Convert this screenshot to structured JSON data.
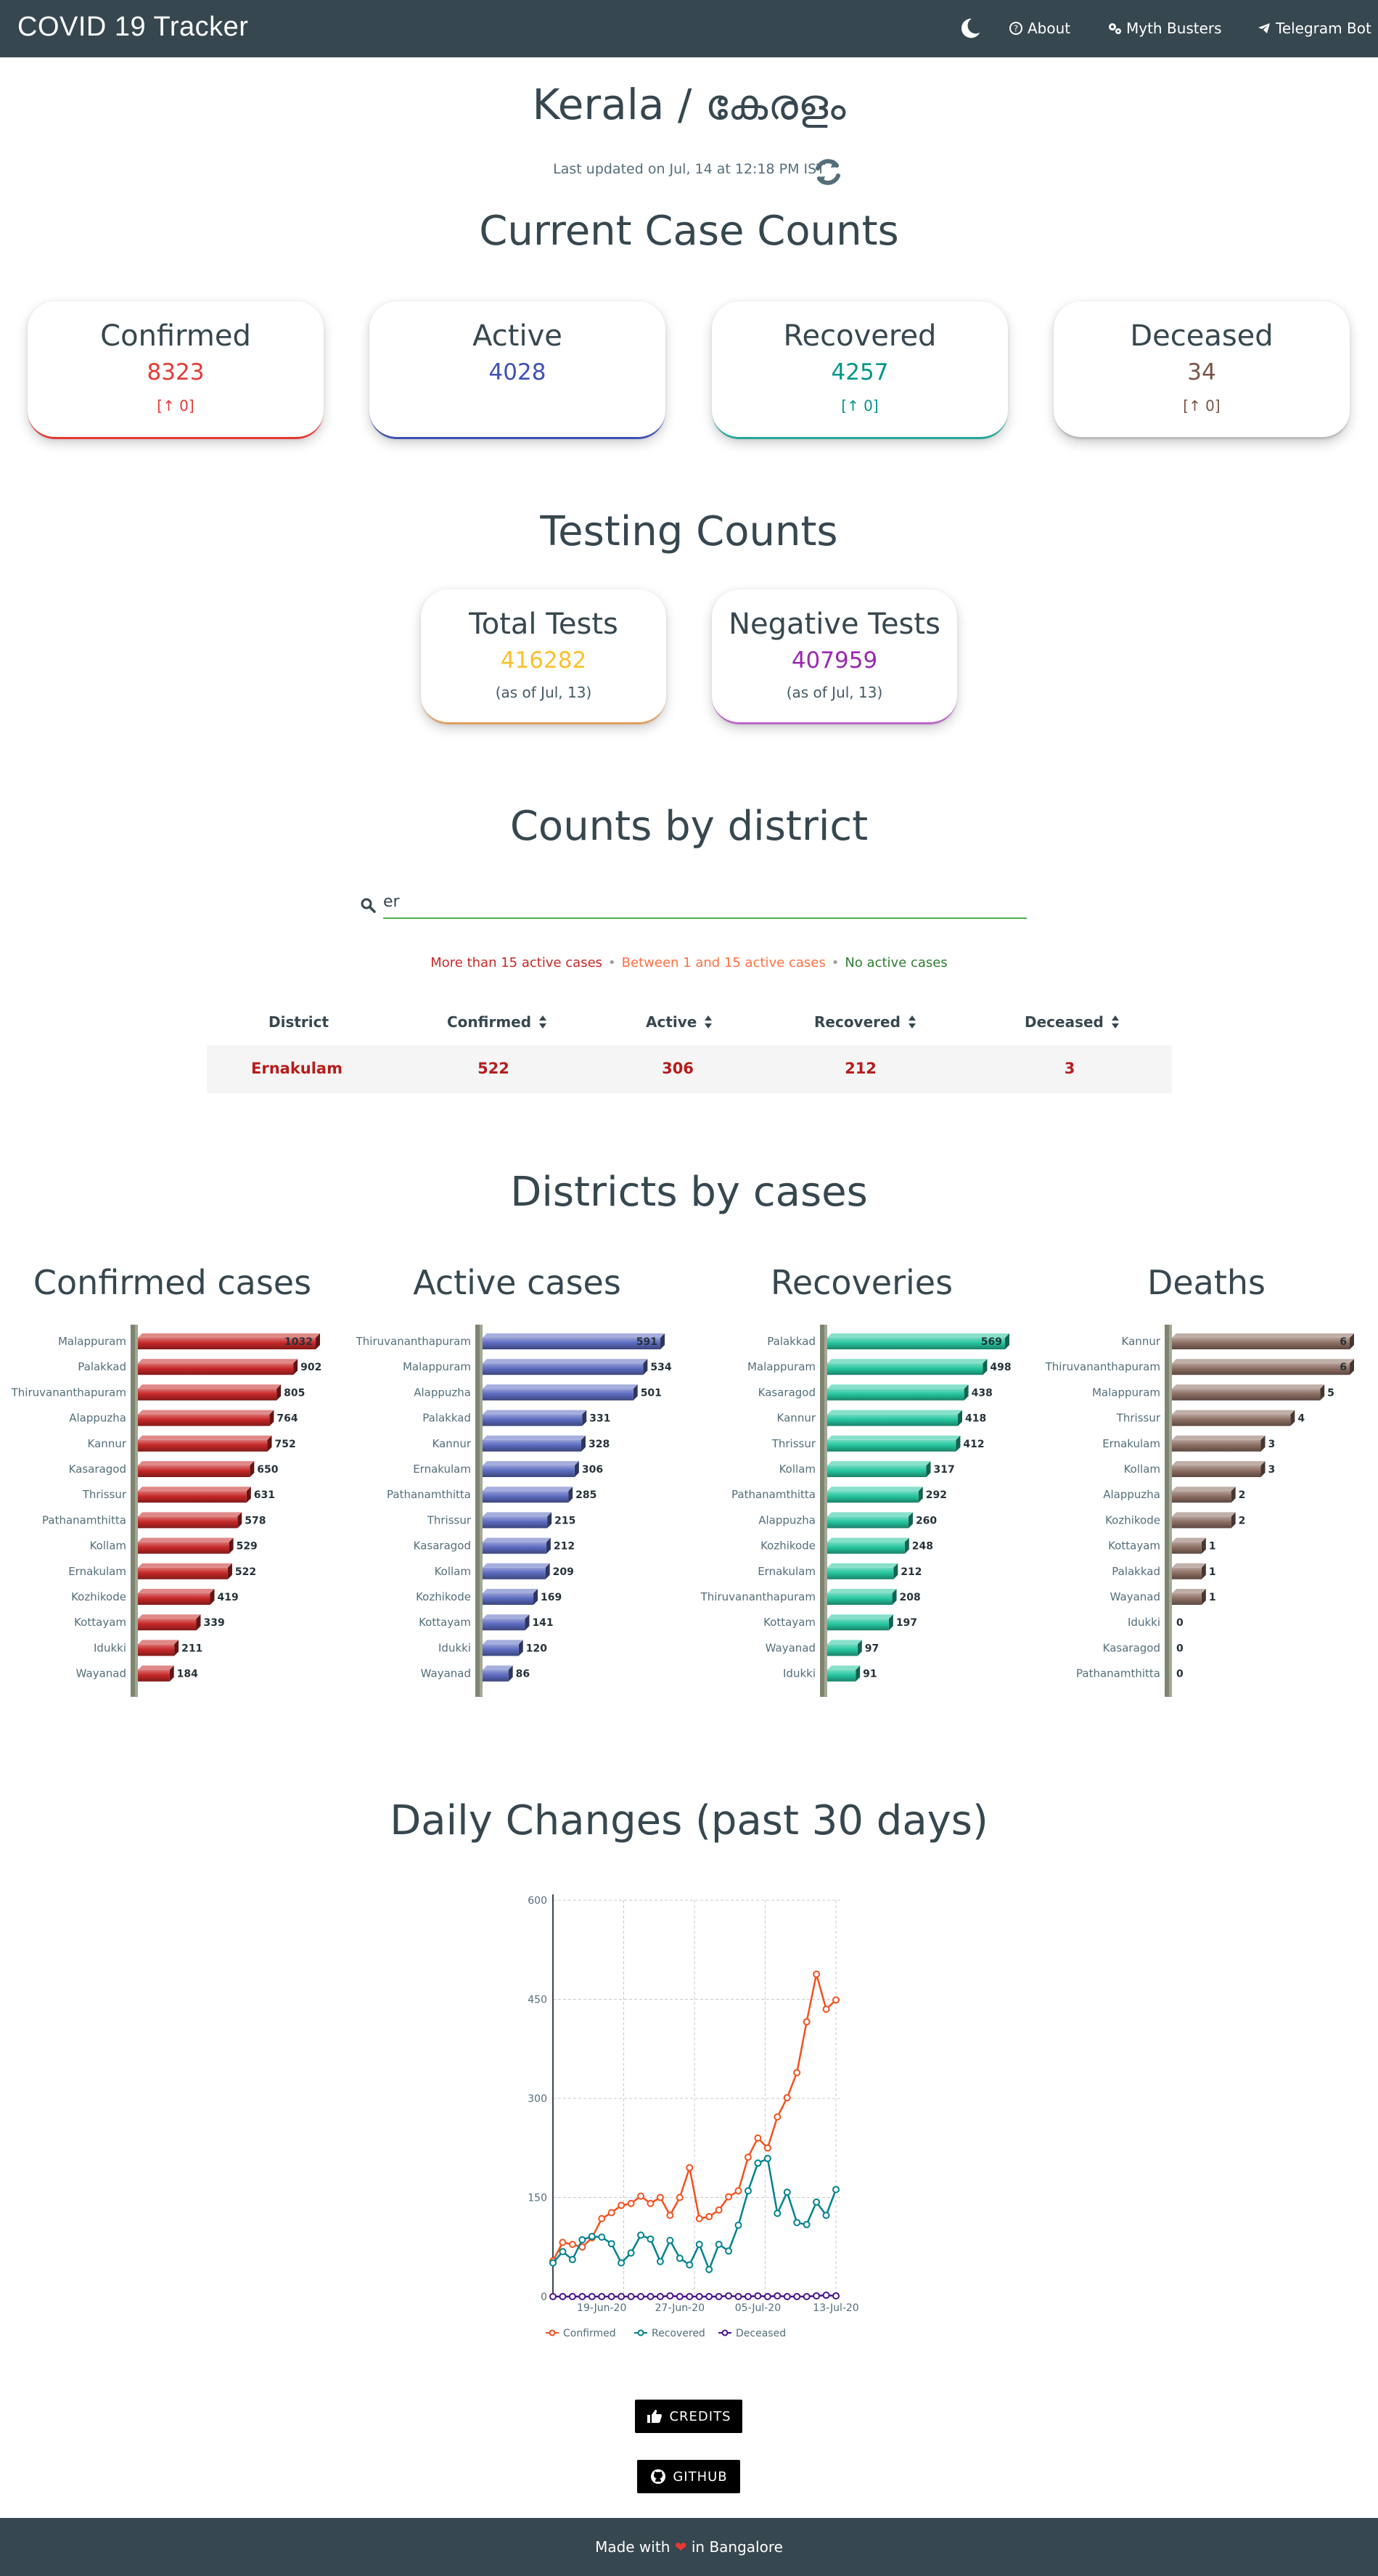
{
  "nav": {
    "brand": "COVID 19 Tracker",
    "about": "About",
    "myth": "Myth Busters",
    "telegram": "Telegram Bot"
  },
  "header": {
    "title": "Kerala / കേരളം",
    "updated": "Last updated on Jul, 14 at 12:18 PM IST"
  },
  "current": {
    "section_title": "Current Case Counts",
    "cards": [
      {
        "title": "Confirmed",
        "value": "8323",
        "delta": "[↑ 0]",
        "color": "#e53935"
      },
      {
        "title": "Active",
        "value": "4028",
        "delta": "",
        "color": "#3f51b5"
      },
      {
        "title": "Recovered",
        "value": "4257",
        "delta": "[↑ 0]",
        "color": "#009688"
      },
      {
        "title": "Deceased",
        "value": "34",
        "delta": "[↑ 0]",
        "color": "#795548"
      }
    ]
  },
  "testing": {
    "section_title": "Testing Counts",
    "cards": [
      {
        "title": "Total Tests",
        "value": "416282",
        "note": "(as of Jul, 13)",
        "color": "#fbc02d"
      },
      {
        "title": "Negative Tests",
        "value": "407959",
        "note": "(as of Jul, 13)",
        "color": "#9c27b0"
      }
    ]
  },
  "district": {
    "section_title": "Counts by district",
    "search_value": "er",
    "legend": {
      "high": "More than 15 active cases",
      "mid": "Between 1 and 15 active cases",
      "none": "No active cases",
      "sep": "•"
    },
    "columns": [
      "District",
      "Confirmed",
      "Active",
      "Recovered",
      "Deceased"
    ],
    "rows": [
      [
        "Ernakulam",
        "522",
        "306",
        "212",
        "3"
      ]
    ]
  },
  "districts_by_cases": {
    "section_title": "Districts by cases",
    "charts": [
      {
        "title": "Confirmed cases",
        "color": "#c62828",
        "labels": [
          "Malappuram",
          "Palakkad",
          "Thiruvananthapuram",
          "Alappuzha",
          "Kannur",
          "Kasaragod",
          "Thrissur",
          "Pathanamthitta",
          "Kollam",
          "Ernakulam",
          "Kozhikode",
          "Kottayam",
          "Idukki",
          "Wayanad"
        ],
        "values": [
          1032,
          902,
          805,
          764,
          752,
          650,
          631,
          578,
          529,
          522,
          419,
          339,
          211,
          184
        ]
      },
      {
        "title": "Active cases",
        "color": "#5c6bc0",
        "labels": [
          "Thiruvananthapuram",
          "Malappuram",
          "Alappuzha",
          "Palakkad",
          "Kannur",
          "Ernakulam",
          "Pathanamthitta",
          "Thrissur",
          "Kasaragod",
          "Kollam",
          "Kozhikode",
          "Kottayam",
          "Idukki",
          "Wayanad"
        ],
        "values": [
          591,
          534,
          501,
          331,
          328,
          306,
          285,
          215,
          212,
          209,
          169,
          141,
          120,
          86
        ]
      },
      {
        "title": "Recoveries",
        "color": "#26c6a0",
        "labels": [
          "Palakkad",
          "Malappuram",
          "Kasaragod",
          "Kannur",
          "Thrissur",
          "Kollam",
          "Pathanamthitta",
          "Alappuzha",
          "Kozhikode",
          "Ernakulam",
          "Thiruvananthapuram",
          "Kottayam",
          "Wayanad",
          "Idukki"
        ],
        "values": [
          569,
          498,
          438,
          418,
          412,
          317,
          292,
          260,
          248,
          212,
          208,
          197,
          97,
          91
        ]
      },
      {
        "title": "Deaths",
        "color": "#8d6e63",
        "labels": [
          "Kannur",
          "Thiruvananthapuram",
          "Malappuram",
          "Thrissur",
          "Ernakulam",
          "Kollam",
          "Alappuzha",
          "Kozhikode",
          "Kottayam",
          "Palakkad",
          "Wayanad",
          "Idukki",
          "Kasaragod",
          "Pathanamthitta"
        ],
        "values": [
          6,
          6,
          5,
          4,
          3,
          3,
          2,
          2,
          1,
          1,
          1,
          0,
          0,
          0
        ]
      }
    ]
  },
  "daily": {
    "section_title": "Daily Changes (past 30 days)"
  },
  "chart_data": {
    "type": "line",
    "x": [
      "14-Jun-20",
      "15-Jun-20",
      "16-Jun-20",
      "17-Jun-20",
      "18-Jun-20",
      "19-Jun-20",
      "20-Jun-20",
      "21-Jun-20",
      "22-Jun-20",
      "23-Jun-20",
      "24-Jun-20",
      "25-Jun-20",
      "26-Jun-20",
      "27-Jun-20",
      "28-Jun-20",
      "29-Jun-20",
      "30-Jun-20",
      "01-Jul-20",
      "02-Jul-20",
      "03-Jul-20",
      "04-Jul-20",
      "05-Jul-20",
      "06-Jul-20",
      "07-Jul-20",
      "08-Jul-20",
      "09-Jul-20",
      "10-Jul-20",
      "11-Jul-20",
      "12-Jul-20",
      "13-Jul-20"
    ],
    "xticks": [
      "19-Jun-20",
      "27-Jun-20",
      "05-Jul-20",
      "13-Jul-20"
    ],
    "ylim": [
      0,
      600
    ],
    "yticks": [
      0,
      150,
      300,
      450,
      600
    ],
    "grid": true,
    "legend_position": "bottom",
    "series": [
      {
        "name": "Confirmed",
        "color": "#f4511e",
        "values": [
          54,
          82,
          79,
          75,
          89,
          118,
          127,
          138,
          141,
          152,
          141,
          150,
          123,
          150,
          195,
          118,
          121,
          131,
          151,
          160,
          211,
          240,
          225,
          272,
          301,
          339,
          416,
          488,
          435,
          449
        ]
      },
      {
        "name": "Recovered",
        "color": "#00838f",
        "values": [
          51,
          68,
          56,
          86,
          91,
          90,
          80,
          51,
          66,
          93,
          87,
          53,
          85,
          58,
          48,
          79,
          41,
          79,
          69,
          108,
          160,
          202,
          209,
          126,
          158,
          112,
          109,
          143,
          123,
          162
        ]
      },
      {
        "name": "Deceased",
        "color": "#4a148c",
        "values": [
          0,
          0,
          0,
          0,
          0,
          0,
          0,
          0,
          0,
          0,
          0,
          0,
          1,
          0,
          0,
          0,
          0,
          0,
          1,
          0,
          0,
          1,
          0,
          1,
          0,
          0,
          0,
          1,
          2,
          1
        ]
      }
    ]
  },
  "buttons": {
    "credits": "CREDITS",
    "github": "GITHUB"
  },
  "footer": {
    "made_with": "Made with",
    "in_place": "in Bangalore"
  }
}
